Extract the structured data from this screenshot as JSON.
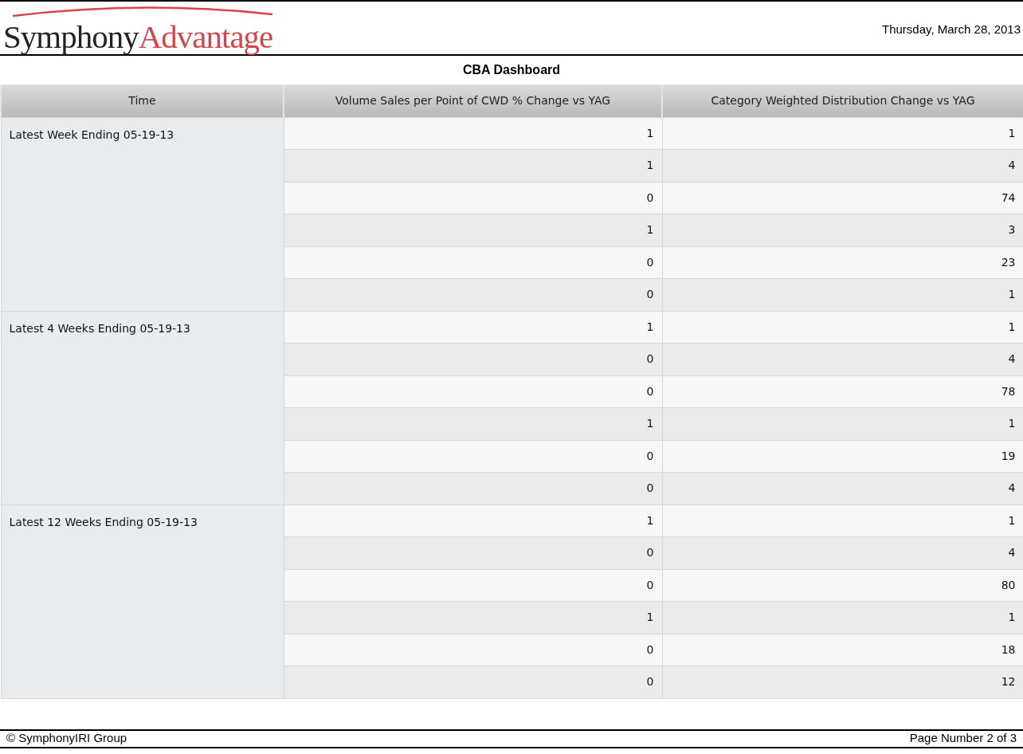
{
  "header": {
    "logo": {
      "part_1": "Symphony",
      "part_2": "Advantage"
    },
    "date": "Thursday, March 28, 2013"
  },
  "title": "CBA Dashboard",
  "table": {
    "columns": [
      "Time",
      "Volume Sales per Point of CWD % Change vs YAG",
      "Category Weighted Distribution Change vs YAG"
    ],
    "groups": [
      {
        "time": "Latest Week Ending 05-19-13",
        "rows": [
          [
            "1",
            "1"
          ],
          [
            "1",
            "4"
          ],
          [
            "0",
            "74"
          ],
          [
            "1",
            "3"
          ],
          [
            "0",
            "23"
          ],
          [
            "0",
            "1"
          ]
        ]
      },
      {
        "time": "Latest 4 Weeks Ending 05-19-13",
        "rows": [
          [
            "1",
            "1"
          ],
          [
            "0",
            "4"
          ],
          [
            "0",
            "78"
          ],
          [
            "1",
            "1"
          ],
          [
            "0",
            "19"
          ],
          [
            "0",
            "4"
          ]
        ]
      },
      {
        "time": "Latest 12 Weeks Ending 05-19-13",
        "rows": [
          [
            "1",
            "1"
          ],
          [
            "0",
            "4"
          ],
          [
            "0",
            "80"
          ],
          [
            "1",
            "1"
          ],
          [
            "0",
            "18"
          ],
          [
            "0",
            "12"
          ]
        ]
      }
    ]
  },
  "footer": {
    "copyright": "© SymphonyIRI Group",
    "page": "Page Number 2 of 3"
  }
}
